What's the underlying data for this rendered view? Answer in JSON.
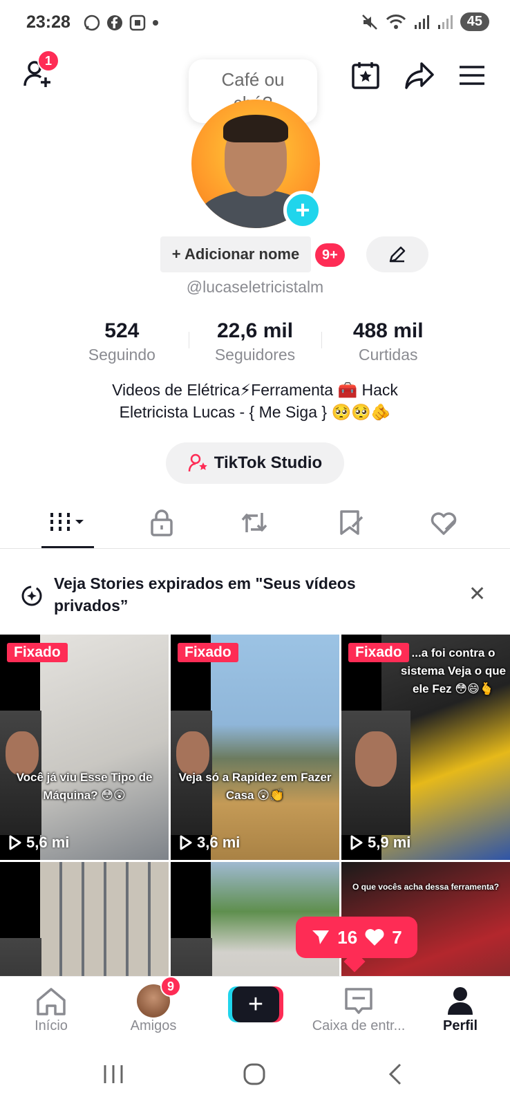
{
  "status_bar": {
    "time": "23:28",
    "battery": "45"
  },
  "header": {
    "friend_requests_badge": "1",
    "bubble_line1": "Café ou",
    "bubble_line2": "chá?"
  },
  "profile": {
    "add_name_label": "+ Adicionar nome",
    "name_badge": "9+",
    "handle": "@lucaseletricistalm",
    "stats": [
      {
        "value": "524",
        "label": "Seguindo"
      },
      {
        "value": "22,6 mil",
        "label": "Seguidores"
      },
      {
        "value": "488 mil",
        "label": "Curtidas"
      }
    ],
    "bio_line1": "Videos de Elétrica⚡Ferramenta 🧰 Hack",
    "bio_line2": "Eletricista Lucas - { Me Siga } 🥺🥺🫵",
    "studio_label": "TikTok Studio"
  },
  "tabs": [
    {
      "icon": "grid-videos-icon",
      "active": true
    },
    {
      "icon": "lock-icon",
      "active": false
    },
    {
      "icon": "repost-icon",
      "active": false
    },
    {
      "icon": "bookmark-icon",
      "active": false
    },
    {
      "icon": "liked-heart-icon",
      "active": false
    }
  ],
  "stories_banner": {
    "text": "Veja Stories expirados em \"Seus vídeos privados”"
  },
  "videos": [
    {
      "fixed": "Fixado",
      "caption": "Você já viu Esse Tipo de Máquina? 😳😲",
      "views": "5,6 mi",
      "colors": [
        "#d8d6d2",
        "#9ea3a7"
      ]
    },
    {
      "fixed": "Fixado",
      "caption": "Veja só a Rapidez em Fazer Casa 😲👏",
      "views": "3,6 mi",
      "colors": [
        "#8fb6d9",
        "#b8924e"
      ]
    },
    {
      "fixed": "Fixado",
      "caption": "...a foi contra o sistema Veja o que ele Fez 😳😄🫰",
      "views": "5,9 mi",
      "colors": [
        "#2a2a2a",
        "#f0c21a"
      ]
    },
    {
      "fixed": "",
      "caption": "",
      "views": "",
      "colors": [
        "#6a6f76",
        "#c9c3b8"
      ]
    },
    {
      "fixed": "",
      "caption": "",
      "views": "",
      "colors": [
        "#9fb9d1",
        "#cfcdc8"
      ]
    },
    {
      "fixed": "",
      "caption": "O que vocês acha dessa ferramenta?",
      "views": "",
      "colors": [
        "#1a1a1a",
        "#b3272d"
      ]
    }
  ],
  "notification": {
    "shares": "16",
    "likes": "7"
  },
  "bottom_nav": {
    "home": "Início",
    "friends": "Amigos",
    "friends_badge": "9",
    "inbox": "Caixa de entr...",
    "profile": "Perfil"
  }
}
